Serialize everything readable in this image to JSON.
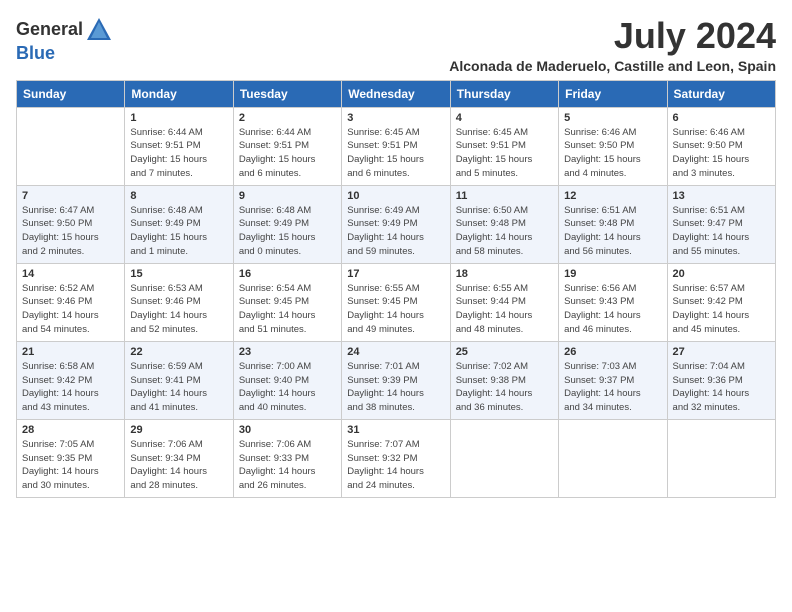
{
  "logo": {
    "general": "General",
    "blue": "Blue"
  },
  "title": "July 2024",
  "location": "Alconada de Maderuelo, Castille and Leon, Spain",
  "columns": [
    "Sunday",
    "Monday",
    "Tuesday",
    "Wednesday",
    "Thursday",
    "Friday",
    "Saturday"
  ],
  "weeks": [
    [
      {
        "num": "",
        "info": ""
      },
      {
        "num": "1",
        "info": "Sunrise: 6:44 AM\nSunset: 9:51 PM\nDaylight: 15 hours\nand 7 minutes."
      },
      {
        "num": "2",
        "info": "Sunrise: 6:44 AM\nSunset: 9:51 PM\nDaylight: 15 hours\nand 6 minutes."
      },
      {
        "num": "3",
        "info": "Sunrise: 6:45 AM\nSunset: 9:51 PM\nDaylight: 15 hours\nand 6 minutes."
      },
      {
        "num": "4",
        "info": "Sunrise: 6:45 AM\nSunset: 9:51 PM\nDaylight: 15 hours\nand 5 minutes."
      },
      {
        "num": "5",
        "info": "Sunrise: 6:46 AM\nSunset: 9:50 PM\nDaylight: 15 hours\nand 4 minutes."
      },
      {
        "num": "6",
        "info": "Sunrise: 6:46 AM\nSunset: 9:50 PM\nDaylight: 15 hours\nand 3 minutes."
      }
    ],
    [
      {
        "num": "7",
        "info": "Sunrise: 6:47 AM\nSunset: 9:50 PM\nDaylight: 15 hours\nand 2 minutes."
      },
      {
        "num": "8",
        "info": "Sunrise: 6:48 AM\nSunset: 9:49 PM\nDaylight: 15 hours\nand 1 minute."
      },
      {
        "num": "9",
        "info": "Sunrise: 6:48 AM\nSunset: 9:49 PM\nDaylight: 15 hours\nand 0 minutes."
      },
      {
        "num": "10",
        "info": "Sunrise: 6:49 AM\nSunset: 9:49 PM\nDaylight: 14 hours\nand 59 minutes."
      },
      {
        "num": "11",
        "info": "Sunrise: 6:50 AM\nSunset: 9:48 PM\nDaylight: 14 hours\nand 58 minutes."
      },
      {
        "num": "12",
        "info": "Sunrise: 6:51 AM\nSunset: 9:48 PM\nDaylight: 14 hours\nand 56 minutes."
      },
      {
        "num": "13",
        "info": "Sunrise: 6:51 AM\nSunset: 9:47 PM\nDaylight: 14 hours\nand 55 minutes."
      }
    ],
    [
      {
        "num": "14",
        "info": "Sunrise: 6:52 AM\nSunset: 9:46 PM\nDaylight: 14 hours\nand 54 minutes."
      },
      {
        "num": "15",
        "info": "Sunrise: 6:53 AM\nSunset: 9:46 PM\nDaylight: 14 hours\nand 52 minutes."
      },
      {
        "num": "16",
        "info": "Sunrise: 6:54 AM\nSunset: 9:45 PM\nDaylight: 14 hours\nand 51 minutes."
      },
      {
        "num": "17",
        "info": "Sunrise: 6:55 AM\nSunset: 9:45 PM\nDaylight: 14 hours\nand 49 minutes."
      },
      {
        "num": "18",
        "info": "Sunrise: 6:55 AM\nSunset: 9:44 PM\nDaylight: 14 hours\nand 48 minutes."
      },
      {
        "num": "19",
        "info": "Sunrise: 6:56 AM\nSunset: 9:43 PM\nDaylight: 14 hours\nand 46 minutes."
      },
      {
        "num": "20",
        "info": "Sunrise: 6:57 AM\nSunset: 9:42 PM\nDaylight: 14 hours\nand 45 minutes."
      }
    ],
    [
      {
        "num": "21",
        "info": "Sunrise: 6:58 AM\nSunset: 9:42 PM\nDaylight: 14 hours\nand 43 minutes."
      },
      {
        "num": "22",
        "info": "Sunrise: 6:59 AM\nSunset: 9:41 PM\nDaylight: 14 hours\nand 41 minutes."
      },
      {
        "num": "23",
        "info": "Sunrise: 7:00 AM\nSunset: 9:40 PM\nDaylight: 14 hours\nand 40 minutes."
      },
      {
        "num": "24",
        "info": "Sunrise: 7:01 AM\nSunset: 9:39 PM\nDaylight: 14 hours\nand 38 minutes."
      },
      {
        "num": "25",
        "info": "Sunrise: 7:02 AM\nSunset: 9:38 PM\nDaylight: 14 hours\nand 36 minutes."
      },
      {
        "num": "26",
        "info": "Sunrise: 7:03 AM\nSunset: 9:37 PM\nDaylight: 14 hours\nand 34 minutes."
      },
      {
        "num": "27",
        "info": "Sunrise: 7:04 AM\nSunset: 9:36 PM\nDaylight: 14 hours\nand 32 minutes."
      }
    ],
    [
      {
        "num": "28",
        "info": "Sunrise: 7:05 AM\nSunset: 9:35 PM\nDaylight: 14 hours\nand 30 minutes."
      },
      {
        "num": "29",
        "info": "Sunrise: 7:06 AM\nSunset: 9:34 PM\nDaylight: 14 hours\nand 28 minutes."
      },
      {
        "num": "30",
        "info": "Sunrise: 7:06 AM\nSunset: 9:33 PM\nDaylight: 14 hours\nand 26 minutes."
      },
      {
        "num": "31",
        "info": "Sunrise: 7:07 AM\nSunset: 9:32 PM\nDaylight: 14 hours\nand 24 minutes."
      },
      {
        "num": "",
        "info": ""
      },
      {
        "num": "",
        "info": ""
      },
      {
        "num": "",
        "info": ""
      }
    ]
  ]
}
